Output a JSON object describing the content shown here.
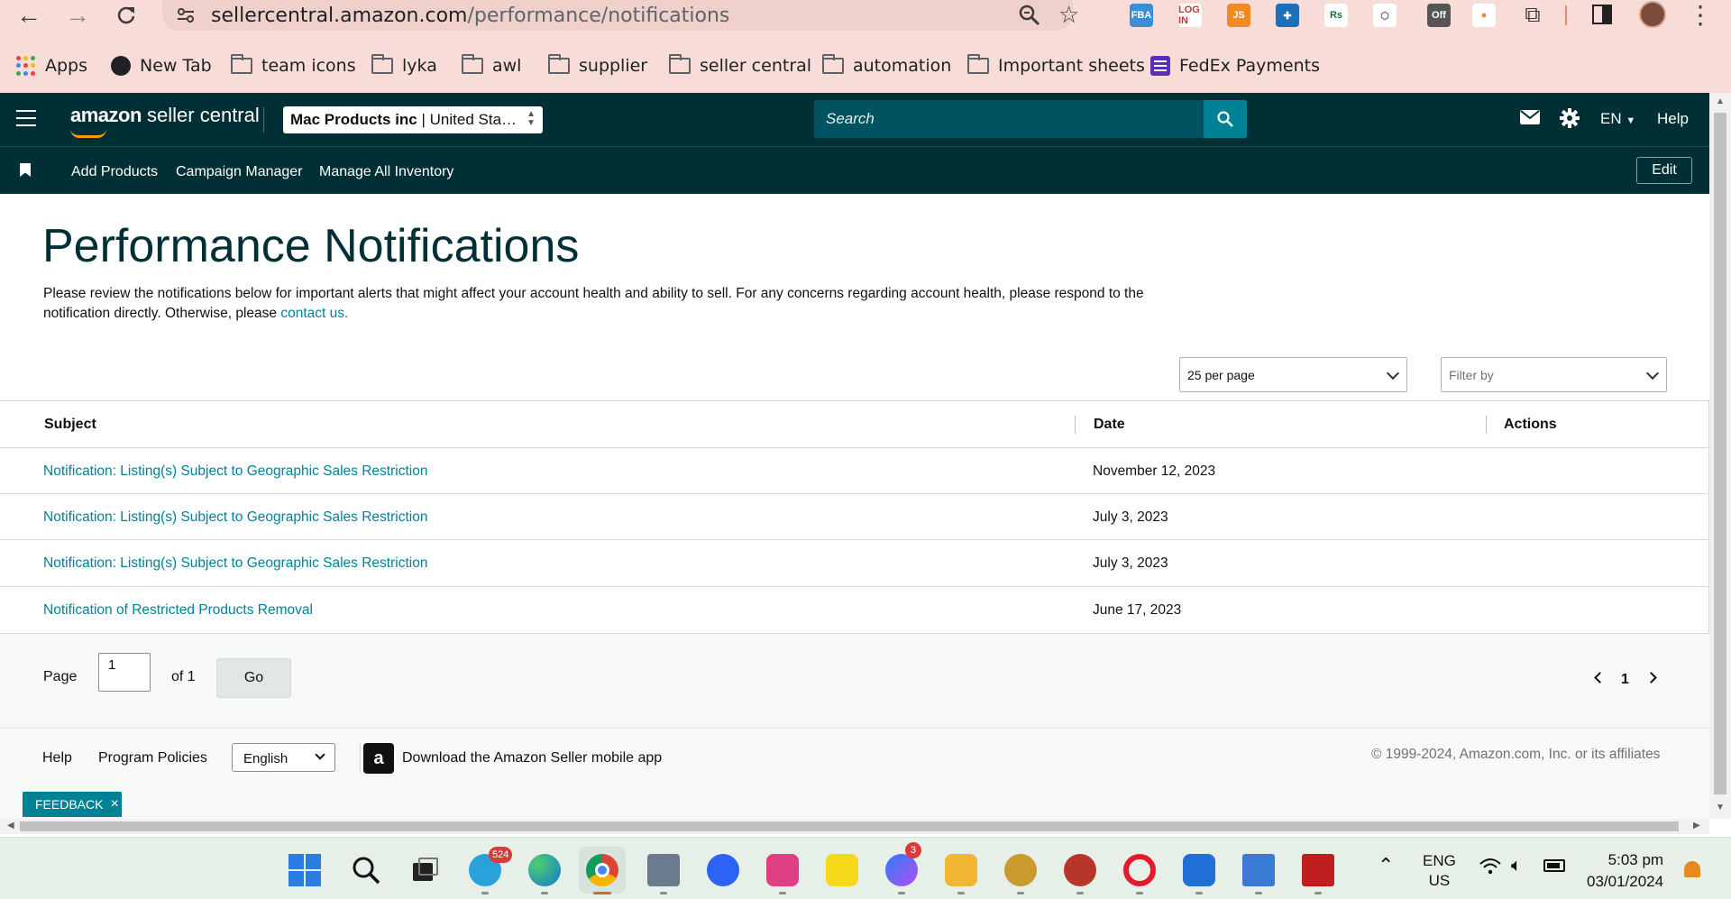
{
  "browser": {
    "url_host": "sellercentral.amazon.com",
    "url_path": "/performance/notifications",
    "extensions": [
      {
        "name": "fba-extension-icon",
        "label": "FBA",
        "color": "#3a8ed8",
        "text_color": "#ffffff"
      },
      {
        "name": "login-extension-icon",
        "label": "LOG IN",
        "color": "#ffffff",
        "text_color": "#c0392b"
      },
      {
        "name": "js-extension-icon",
        "label": "JS",
        "color": "#f08a24",
        "text_color": "#ffffff"
      },
      {
        "name": "plus-extension-icon",
        "label": "✚",
        "color": "#1d6fb8",
        "text_color": "#ffffff"
      },
      {
        "name": "rs-extension-icon",
        "label": "Rs",
        "color": "#ffffff",
        "text_color": "#1b6e3a"
      },
      {
        "name": "cube-extension-icon",
        "label": "⬡",
        "color": "#ffffff",
        "text_color": "#666666"
      },
      {
        "name": "off-extension-icon",
        "label": "Off",
        "color": "#555555",
        "text_color": "#ffffff"
      },
      {
        "name": "orange-circle-extension-icon",
        "label": "●",
        "color": "#ffffff",
        "text_color": "#f0822a"
      }
    ],
    "bookmarks": [
      {
        "name": "bookmark-apps",
        "label": "Apps",
        "icon": "apps-icon"
      },
      {
        "name": "bookmark-new-tab",
        "label": "New Tab",
        "icon": "globe-icon"
      },
      {
        "name": "bookmark-team-icons",
        "label": "team icons",
        "icon": "folder-icon"
      },
      {
        "name": "bookmark-lyka",
        "label": "lyka",
        "icon": "folder-icon"
      },
      {
        "name": "bookmark-awl",
        "label": "awl",
        "icon": "folder-icon"
      },
      {
        "name": "bookmark-supplier",
        "label": "supplier",
        "icon": "folder-icon"
      },
      {
        "name": "bookmark-seller-central",
        "label": "seller central",
        "icon": "folder-icon"
      },
      {
        "name": "bookmark-automation",
        "label": "automation",
        "icon": "folder-icon"
      },
      {
        "name": "bookmark-important-sheets",
        "label": "Important sheets",
        "icon": "folder-icon"
      },
      {
        "name": "bookmark-fedex-payments",
        "label": "FedEx Payments",
        "icon": "list-icon"
      }
    ]
  },
  "header": {
    "logo_brand": "amazon",
    "logo_product": " seller central",
    "account_name": "Mac Products inc",
    "account_sep": " | ",
    "account_region": "United Sta…",
    "search_placeholder": "Search",
    "language": "EN",
    "help": "Help",
    "brand_color": "#002f36",
    "accent_color": "#008296"
  },
  "subnav": {
    "links": [
      "Add Products",
      "Campaign Manager",
      "Manage All Inventory"
    ],
    "edit_label": "Edit"
  },
  "main": {
    "title": "Performance Notifications",
    "description": "Please review the notifications below for important alerts that might affect your account health and ability to sell. For any concerns regarding account health, please respond to the notification directly. Otherwise, please ",
    "contact_link": "contact us.",
    "per_page": "25 per page",
    "filter_placeholder": "Filter by"
  },
  "table": {
    "headers": {
      "subject": "Subject",
      "date": "Date",
      "actions": "Actions"
    },
    "rows": [
      {
        "subject": "Notification: Listing(s) Subject to Geographic Sales Restriction",
        "date": "November 12, 2023"
      },
      {
        "subject": "Notification: Listing(s) Subject to Geographic Sales Restriction",
        "date": "July 3, 2023"
      },
      {
        "subject": "Notification: Listing(s) Subject to Geographic Sales Restriction",
        "date": "July 3, 2023"
      },
      {
        "subject": "Notification of Restricted Products Removal",
        "date": "June 17, 2023"
      }
    ]
  },
  "pager": {
    "page_label": "Page",
    "page_value": "1",
    "of_label": "of 1",
    "go_label": "Go",
    "current_page": "1"
  },
  "footer": {
    "help": "Help",
    "program_policies": "Program Policies",
    "language": "English",
    "download_app": "Download the Amazon Seller mobile app",
    "app_icon_letter": "a",
    "copyright": "© 1999-2024, Amazon.com, Inc. or its affiliates",
    "feedback": "FEEDBACK",
    "feedback_close": "×"
  },
  "taskbar": {
    "telegram_badge": "524",
    "messenger_badge": "3",
    "lang_line1": "ENG",
    "lang_line2": "US",
    "time": "5:03 pm",
    "date": "03/01/2024"
  }
}
